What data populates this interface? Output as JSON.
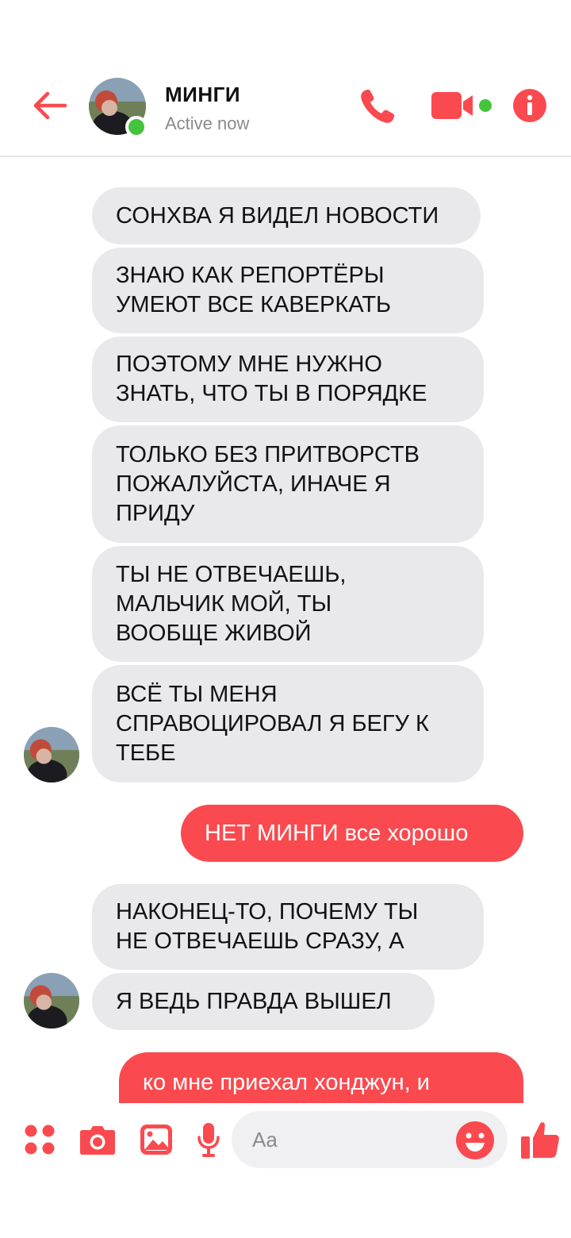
{
  "header": {
    "name": "МИНГИ",
    "status": "Active now"
  },
  "colors": {
    "accent": "#fa4a4f",
    "online": "#44c43a",
    "incoming_bubble": "#e9e8eb"
  },
  "messages": [
    {
      "side": "in",
      "text": "СОНХВА Я ВИДЕЛ НОВОСТИ"
    },
    {
      "side": "in",
      "text": "ЗНАЮ КАК РЕПОРТЁРЫ\nУМЕЮТ ВСЕ КАВЕРКАТЬ"
    },
    {
      "side": "in",
      "text": "ПОЭТОМУ МНЕ НУЖНО\nЗНАТЬ, ЧТО ТЫ В ПОРЯДКЕ"
    },
    {
      "side": "in",
      "text": "ТОЛЬКО БЕЗ ПРИТВОРСТВ\nПОЖАЛУЙСТА, ИНАЧЕ Я\nПРИДУ"
    },
    {
      "side": "in",
      "text": "ТЫ НЕ ОТВЕЧАЕШЬ,\nМАЛЬЧИК МОЙ, ТЫ\nВООБЩЕ ЖИВОЙ"
    },
    {
      "side": "in",
      "text": "ВСЁ ТЫ МЕНЯ\nСПРАВОЦИРОВАЛ Я БЕГУ К\nТЕБЕ"
    },
    {
      "side": "out",
      "text": "НЕТ МИНГИ все хорошо"
    },
    {
      "side": "in",
      "text": "НАКОНЕЦ-ТО, ПОЧЕМУ ТЫ\nНЕ ОТВЕЧАЕШЬ СРАЗУ, А"
    },
    {
      "side": "in",
      "text": "Я ВЕДЬ ПРАВДА ВЫШЕЛ"
    },
    {
      "side": "out",
      "text": "ко мне приехал хонджун, и"
    }
  ],
  "composer": {
    "placeholder": "Aa",
    "icons": [
      "apps-icon",
      "camera-icon",
      "gallery-icon",
      "microphone-icon",
      "emoji-icon",
      "thumbs-up-icon"
    ]
  }
}
